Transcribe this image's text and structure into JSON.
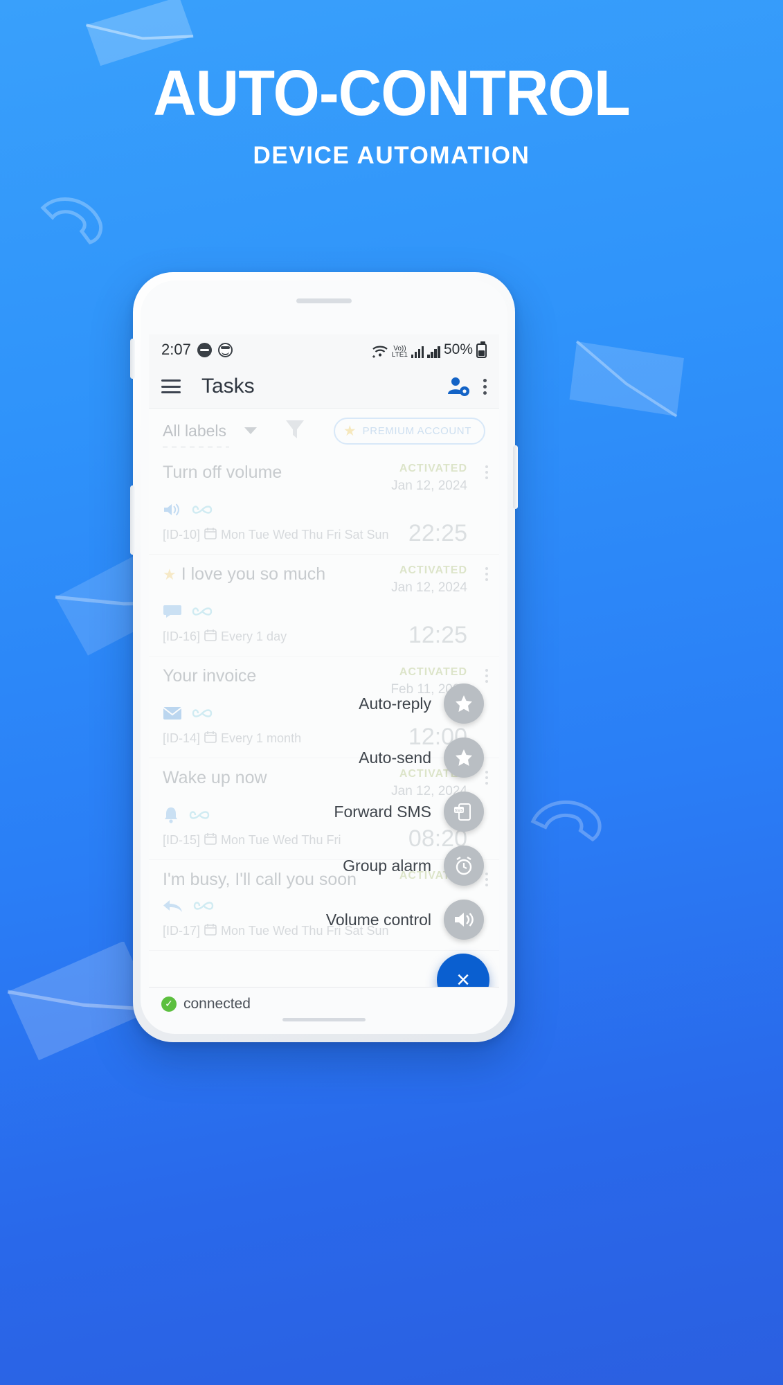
{
  "page": {
    "headline": "AUTO-CONTROL",
    "subheadline": "DEVICE AUTOMATION",
    "background_color": "#2f93fa",
    "accent_color": "#0a5fd0"
  },
  "status_bar": {
    "time": "2:07",
    "dnd_icon": "do-not-disturb-icon",
    "face_icon": "face-icon",
    "wifi_icon": "wifi-icon",
    "network_label_top": "Vo))",
    "network_label_bottom": "LTE1",
    "battery_percent": "50%",
    "battery_icon": "battery-icon"
  },
  "toolbar": {
    "menu_icon": "hamburger-menu-icon",
    "title": "Tasks",
    "account_icon": "person-settings-icon",
    "overflow_icon": "more-vertical-icon"
  },
  "filter_bar": {
    "label_select": "All labels",
    "dropdown_icon": "chevron-down-icon",
    "filter_icon": "funnel-filter-icon",
    "premium_label": "PREMIUM ACCOUNT",
    "premium_star_icon": "star-icon"
  },
  "tasks": [
    {
      "name": "Turn off volume",
      "starred": false,
      "state": "ACTIVATED",
      "date": "Jan 12, 2024",
      "time": "22:25",
      "id": "[ID-10]",
      "schedule": "Mon Tue Wed Thu Fri Sat Sun",
      "type_icon": "volume-icon",
      "repeat_icon": "infinity-icon",
      "calendar_icon": "calendar-icon",
      "menu_icon": "more-vertical-icon"
    },
    {
      "name": "I love you so much",
      "starred": true,
      "state": "ACTIVATED",
      "date": "Jan 12, 2024",
      "time": "12:25",
      "id": "[ID-16]",
      "schedule": "Every 1 day",
      "type_icon": "chat-bubble-icon",
      "repeat_icon": "infinity-icon",
      "calendar_icon": "calendar-icon",
      "menu_icon": "more-vertical-icon"
    },
    {
      "name": "Your invoice",
      "starred": false,
      "state": "ACTIVATED",
      "date": "Feb 11, 2024",
      "time": "12:00",
      "id": "[ID-14]",
      "schedule": "Every 1 month",
      "type_icon": "envelope-icon",
      "repeat_icon": "infinity-icon",
      "calendar_icon": "calendar-icon",
      "menu_icon": "more-vertical-icon"
    },
    {
      "name": "Wake up now",
      "starred": false,
      "state": "ACTIVATED",
      "date": "Jan 12, 2024",
      "time": "08:20",
      "id": "[ID-15]",
      "schedule": "Mon Tue Wed Thu Fri",
      "type_icon": "bell-icon",
      "repeat_icon": "infinity-icon",
      "calendar_icon": "calendar-icon",
      "menu_icon": "more-vertical-icon"
    },
    {
      "name": "I'm busy, I'll call you soon",
      "starred": false,
      "state": "ACTIVATED",
      "date": "",
      "time": "",
      "id": "[ID-17]",
      "schedule": "Mon Tue Wed Thu Fri Sat Sun",
      "type_icon": "reply-icon",
      "repeat_icon": "infinity-icon",
      "calendar_icon": "calendar-icon",
      "menu_icon": "more-vertical-icon"
    }
  ],
  "speed_dial": {
    "items": [
      {
        "label": "Auto-reply",
        "icon": "star-icon"
      },
      {
        "label": "Auto-send",
        "icon": "star-icon"
      },
      {
        "label": "Forward SMS",
        "icon": "sms-forward-icon"
      },
      {
        "label": "Group alarm",
        "icon": "alarm-clock-icon"
      },
      {
        "label": "Volume control",
        "icon": "volume-icon"
      }
    ],
    "main_button_icon": "close-icon",
    "main_button_label": "×"
  },
  "status_footer": {
    "icon": "check-circle-icon",
    "text": "connected"
  }
}
